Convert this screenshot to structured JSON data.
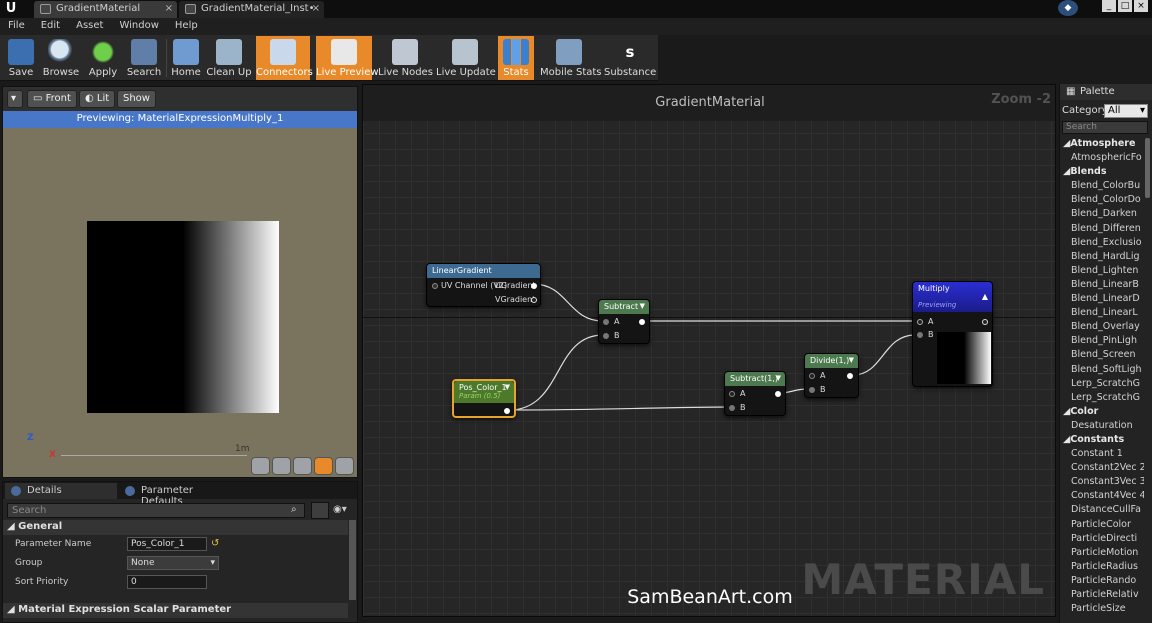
{
  "window": {
    "tabs": [
      {
        "label": "GradientMaterial"
      },
      {
        "label": "GradientMaterial_Inst•"
      }
    ]
  },
  "menu": [
    "File",
    "Edit",
    "Asset",
    "Window",
    "Help"
  ],
  "toolbar": {
    "buttons": [
      {
        "label": "Save",
        "icon": "floppy-disk-icon",
        "active": false
      },
      {
        "label": "Browse",
        "icon": "magnifier-browse-icon",
        "active": false
      },
      {
        "label": "Apply",
        "icon": "checkmark-icon",
        "active": false
      },
      {
        "label": "Search",
        "icon": "binoculars-icon",
        "active": false
      },
      {
        "label": "Home",
        "icon": "house-icon",
        "active": false
      },
      {
        "label": "Clean Up",
        "icon": "broom-icon",
        "active": false
      },
      {
        "label": "Connectors",
        "icon": "connectors-icon",
        "active": true
      },
      {
        "label": "Live Preview",
        "icon": "live-preview-icon",
        "active": true
      },
      {
        "label": "Live Nodes",
        "icon": "live-nodes-icon",
        "active": false
      },
      {
        "label": "Live Update",
        "icon": "live-update-icon",
        "active": false
      },
      {
        "label": "Stats",
        "icon": "stats-bars-icon",
        "active": true
      },
      {
        "label": "Mobile Stats",
        "icon": "mobile-stats-icon",
        "active": false
      },
      {
        "label": "Substance",
        "icon": "substance-icon",
        "active": false
      }
    ]
  },
  "viewport": {
    "buttons": {
      "front": "Front",
      "lit": "Lit",
      "show": "Show"
    },
    "banner": "Previewing: MaterialExpressionMultiply_1",
    "scale_label": "1m",
    "axis_z": "Z",
    "axis_x": "X"
  },
  "details": {
    "tabs": [
      {
        "label": "Details"
      },
      {
        "label": "Parameter Defaults"
      }
    ],
    "search_placeholder": "Search",
    "section_general": "General",
    "rows": {
      "parameter_name": {
        "label": "Parameter Name",
        "value": "Pos_Color_1"
      },
      "group": {
        "label": "Group",
        "value": "None"
      },
      "sort_priority": {
        "label": "Sort Priority",
        "value": "0"
      }
    },
    "section_scalar": "Material Expression Scalar Parameter"
  },
  "graph": {
    "title": "GradientMaterial",
    "zoom": "Zoom -2",
    "watermark": "MATERIAL",
    "credit": "SamBeanArt.com",
    "nodes": {
      "linear_gradient": {
        "title": "LinearGradient",
        "input": "UV Channel (V2)",
        "out1": "UGradient",
        "out2": "VGradient",
        "color": "#3d6a90"
      },
      "subtract": {
        "title": "Subtract",
        "a": "A",
        "b": "B",
        "color": "#4c7a4e"
      },
      "pos_color": {
        "title": "Pos_Color_1",
        "subtitle": "Param (0.5)",
        "color": "#4c7a2a"
      },
      "subtract1": {
        "title": "Subtract(1,)",
        "a": "A",
        "b": "B",
        "color": "#4c7a4e"
      },
      "divide": {
        "title": "Divide(1,)",
        "a": "A",
        "b": "B",
        "color": "#4c7a4e"
      },
      "multiply": {
        "title": "Multiply",
        "subtitle": "Previewing",
        "a": "A",
        "b": "B",
        "color": "#1d1ea0"
      }
    }
  },
  "palette": {
    "title": "Palette",
    "category_label": "Category:",
    "category_value": "All",
    "search_placeholder": "Search",
    "items": [
      {
        "label": "Atmosphere",
        "cat": true
      },
      {
        "label": "AtmosphericFo",
        "cat": false
      },
      {
        "label": "Blends",
        "cat": true
      },
      {
        "label": "Blend_ColorBu",
        "cat": false
      },
      {
        "label": "Blend_ColorDo",
        "cat": false
      },
      {
        "label": "Blend_Darken",
        "cat": false
      },
      {
        "label": "Blend_Differen",
        "cat": false
      },
      {
        "label": "Blend_Exclusio",
        "cat": false
      },
      {
        "label": "Blend_HardLig",
        "cat": false
      },
      {
        "label": "Blend_Lighten",
        "cat": false
      },
      {
        "label": "Blend_LinearB",
        "cat": false
      },
      {
        "label": "Blend_LinearD",
        "cat": false
      },
      {
        "label": "Blend_LinearL",
        "cat": false
      },
      {
        "label": "Blend_Overlay",
        "cat": false
      },
      {
        "label": "Blend_PinLigh",
        "cat": false
      },
      {
        "label": "Blend_Screen",
        "cat": false
      },
      {
        "label": "Blend_SoftLigh",
        "cat": false
      },
      {
        "label": "Lerp_ScratchG",
        "cat": false
      },
      {
        "label": "Lerp_ScratchG",
        "cat": false
      },
      {
        "label": "Color",
        "cat": true
      },
      {
        "label": "Desaturation",
        "cat": false
      },
      {
        "label": "Constants",
        "cat": true
      },
      {
        "label": "Constant       1",
        "cat": false
      },
      {
        "label": "Constant2Vec 2",
        "cat": false
      },
      {
        "label": "Constant3Vec 3",
        "cat": false
      },
      {
        "label": "Constant4Vec 4",
        "cat": false
      },
      {
        "label": "DistanceCullFa",
        "cat": false
      },
      {
        "label": "ParticleColor",
        "cat": false
      },
      {
        "label": "ParticleDirecti",
        "cat": false
      },
      {
        "label": "ParticleMotion",
        "cat": false
      },
      {
        "label": "ParticleRadius",
        "cat": false
      },
      {
        "label": "ParticleRando",
        "cat": false
      },
      {
        "label": "ParticleRelativ",
        "cat": false
      },
      {
        "label": "ParticleSize",
        "cat": false
      }
    ]
  }
}
